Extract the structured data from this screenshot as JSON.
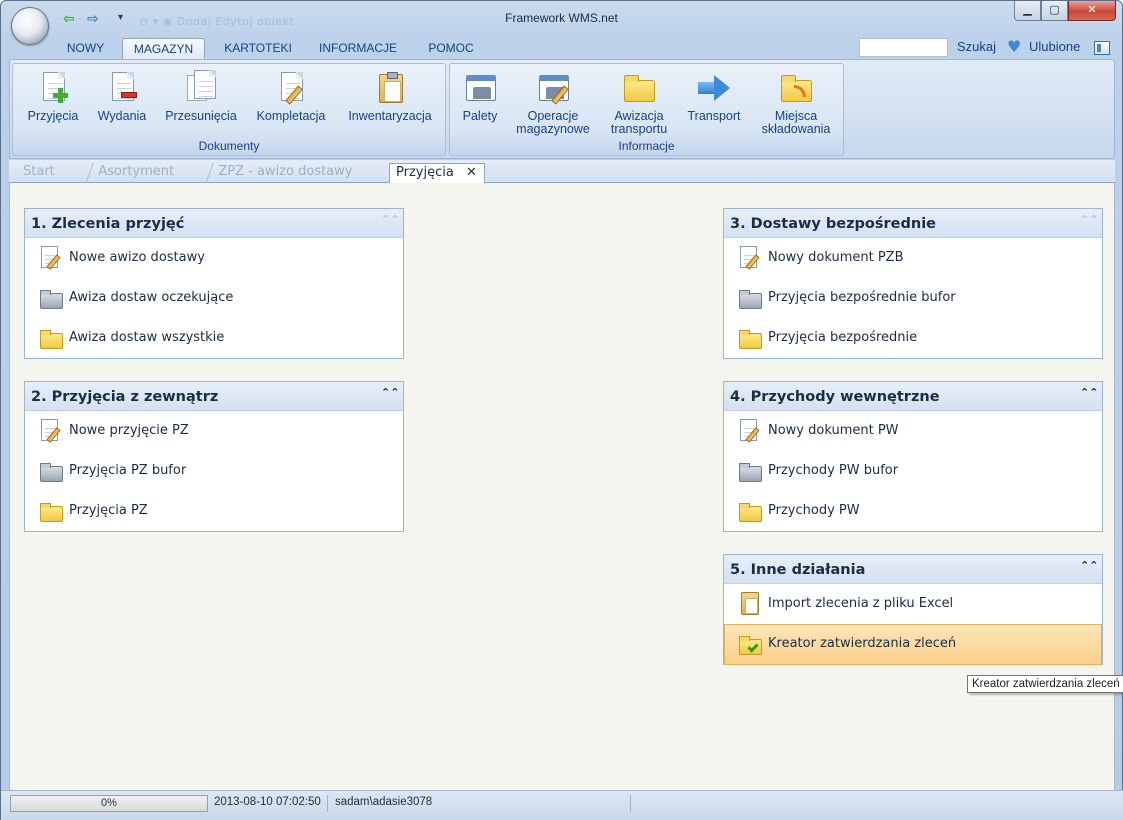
{
  "window": {
    "title": "Framework WMS.net",
    "minimize_symbol": "▁",
    "maximize_symbol": "▢",
    "close_symbol": "✕",
    "qat_faded_text": "⊖ ▾    ◉    Dodaj    Edytuj obiekt"
  },
  "ribbon_tabs": [
    {
      "label": "NOWY"
    },
    {
      "label": "MAGAZYN"
    },
    {
      "label": "KARTOTEKI"
    },
    {
      "label": "INFORMACJE"
    },
    {
      "label": "POMOC"
    }
  ],
  "search": {
    "label": "Szukaj",
    "value": ""
  },
  "favorites": {
    "label": "Ulubione"
  },
  "groups": {
    "dokumenty": {
      "label": "Dokumenty",
      "buttons": [
        {
          "label": "Przyjęcia",
          "icon": "document-add-icon"
        },
        {
          "label": "Wydania",
          "icon": "document-remove-icon"
        },
        {
          "label": "Przesunięcia",
          "icon": "documents-icon"
        },
        {
          "label": "Kompletacja",
          "icon": "document-edit-icon"
        },
        {
          "label": "Inwentaryzacja",
          "icon": "clipboard-icon"
        }
      ]
    },
    "informacje": {
      "label": "Informacje",
      "buttons": [
        {
          "label": "Palety",
          "icon": "calendar-icon"
        },
        {
          "label1": "Operacje",
          "label2": "magazynowe",
          "icon": "calendar-edit-icon"
        },
        {
          "label1": "Awizacja",
          "label2": "transportu",
          "icon": "folder-icon"
        },
        {
          "label": "Transport",
          "icon": "arrow-right-icon"
        },
        {
          "label1": "Miejsca",
          "label2": "składowania",
          "icon": "folder-rss-icon"
        }
      ]
    }
  },
  "doc_tabs": [
    {
      "label": "Start"
    },
    {
      "label": "Asortyment"
    },
    {
      "label": "ZPZ - awizo dostawy"
    },
    {
      "label": "Przyjęcia",
      "close": "✕"
    }
  ],
  "panels": [
    {
      "title": "1. Zlecenia przyjęć",
      "items": [
        "Nowe awizo dostawy",
        "Awiza dostaw oczekujące",
        "Awiza dostaw wszystkie"
      ]
    },
    {
      "title": "2. Przyjęcia z zewnątrz",
      "items": [
        "Nowe przyjęcie PZ",
        "Przyjęcia PZ bufor",
        "Przyjęcia PZ"
      ]
    },
    {
      "title": "3. Dostawy bezpośrednie",
      "items": [
        "Nowy dokument PZB",
        "Przyjęcia bezpośrednie bufor",
        "Przyjęcia bezpośrednie"
      ]
    },
    {
      "title": "4. Przychody wewnętrzne",
      "items": [
        "Nowy dokument PW",
        "Przychody PW bufor",
        "Przychody PW"
      ]
    },
    {
      "title": "5. Inne działania",
      "items": [
        "Import zlecenia z pliku Excel",
        "Kreator zatwierdzania zleceń"
      ]
    }
  ],
  "collapse_symbol": "⌃⌃",
  "tooltip": "Kreator zatwierdzania zleceń",
  "status": {
    "progress_text": "0%",
    "progress_value": 0,
    "datetime": "2013-08-10 07:02:50",
    "user": "sadam\\adasie3078"
  },
  "colors": {
    "accent": "#15428b",
    "ribbon_bg": "#d0def0",
    "hover_item": "#fbd08b",
    "close_button": "#c9463a"
  }
}
